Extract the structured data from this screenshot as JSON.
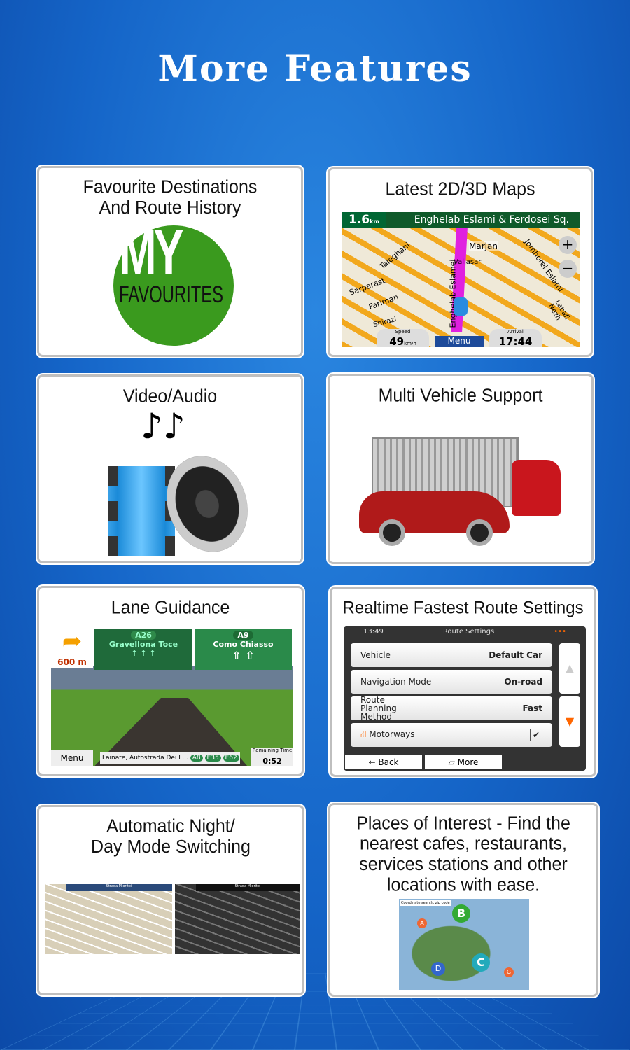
{
  "page": {
    "title": "More Features"
  },
  "cards": [
    {
      "title": "Favourite Destinations\nAnd Route History",
      "logo_text": "MY FAVOURITES",
      "accent": "#3a9a1e"
    },
    {
      "title": "Latest 2D/3D Maps",
      "map": {
        "distance": "1.6",
        "distance_unit": "km",
        "street": "Enghelab Eslami & Ferdosei Sq.",
        "labels": [
          "Marjan",
          "Valiasar",
          "Taleghani",
          "Sarparast",
          "Fariman",
          "Jomhorei Eslami",
          "Labafi Nezh",
          "Enghelab Eslamei",
          "Shirazi"
        ],
        "speed_label": "Speed",
        "speed": "49",
        "speed_unit": "km/h",
        "menu": "Menu",
        "arrival_label": "Arrival",
        "arrival": "17:44"
      }
    },
    {
      "title": "Video/Audio"
    },
    {
      "title": "Multi Vehicle Support"
    },
    {
      "title": "Lane Guidance",
      "nav": {
        "distance": "600 m",
        "sign1_road": "A26",
        "sign1_dest": "Gravellona Toce",
        "sign2_road": "A9",
        "sign2_dest": "Como Chiasso",
        "menu": "Menu",
        "street": "Lainate, Autostrada Dei L...",
        "badges": [
          "A8",
          "E35",
          "E62"
        ],
        "remaining_label": "Remaining Time",
        "remaining": "0:52"
      }
    },
    {
      "title": "Realtime Fastest Route Settings",
      "settings": {
        "time": "13:49",
        "header": "Route Settings",
        "rows": [
          {
            "label": "Vehicle",
            "value": "Default Car"
          },
          {
            "label": "Navigation Mode",
            "value": "On-road"
          },
          {
            "label": "Route Planning Method",
            "value": "Fast"
          },
          {
            "label": "Motorways",
            "value": "checked"
          }
        ],
        "back": "Back",
        "more": "More"
      }
    },
    {
      "title": "Automatic Night/\nDay Mode Switching",
      "street": "Strada Mioritei"
    },
    {
      "title": "Places of Interest - Find the nearest cafes, restaurants, services stations and other locations with ease.",
      "pins": [
        "A",
        "B",
        "C",
        "D",
        "G"
      ],
      "search_label": "Coordinate search, zip code"
    }
  ]
}
